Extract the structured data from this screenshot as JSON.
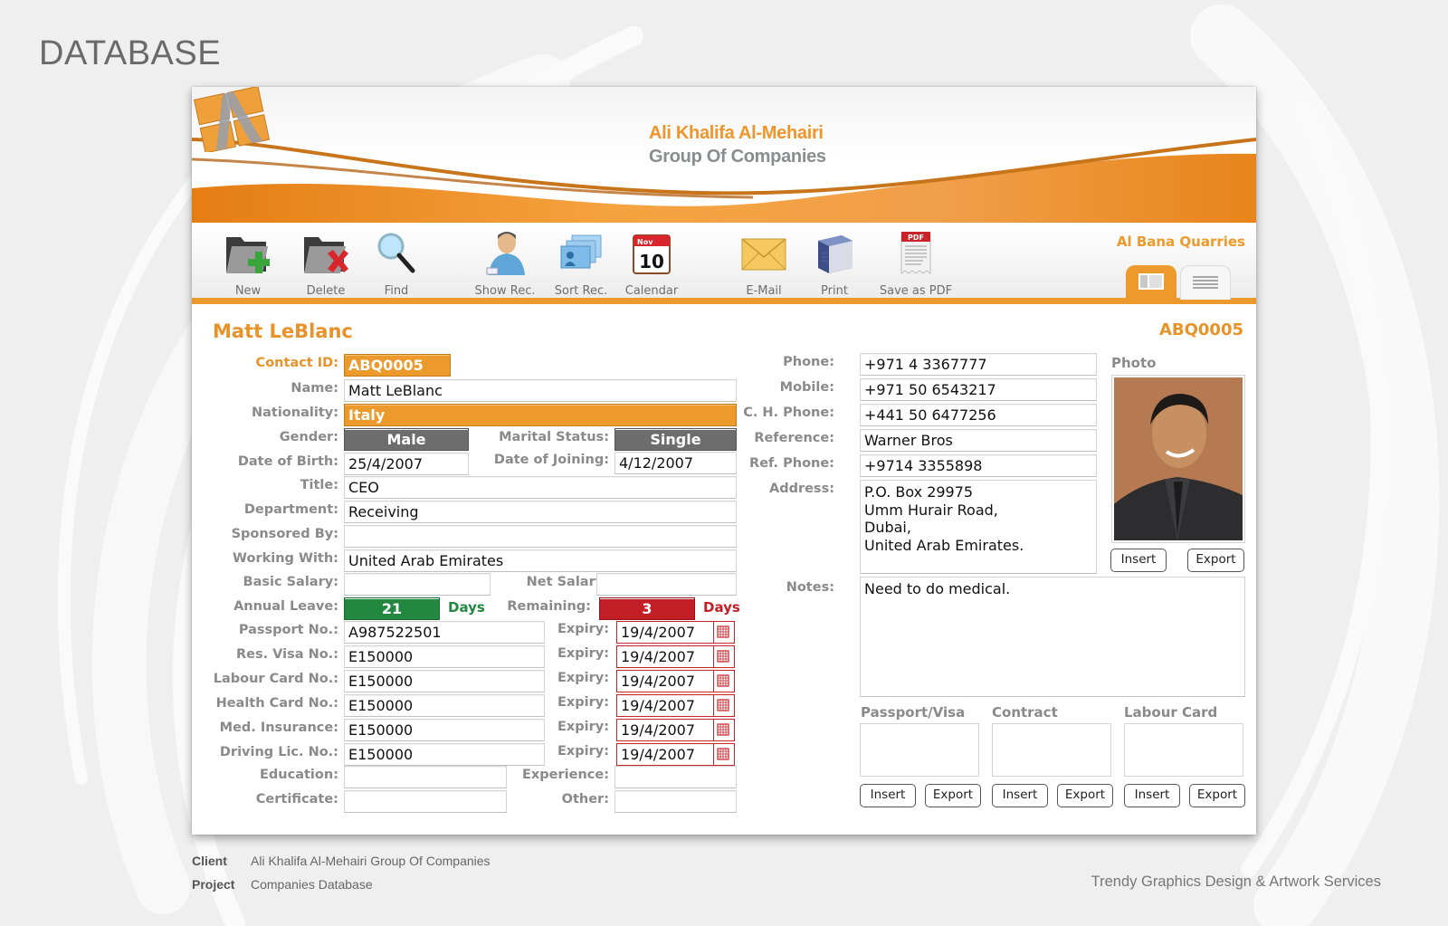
{
  "page": {
    "heading": "DATABASE",
    "footer": {
      "client_key": "Client",
      "client_value": "Ali Khalifa Al-Mehairi Group Of Companies",
      "project_key": "Project",
      "project_value": "Companies Database",
      "credit": "Trendy Graphics Design & Artwork Services"
    }
  },
  "banner": {
    "brand_line1": "Ali Khalifa Al-Mehairi",
    "brand_line2": "Group Of Companies",
    "calendar_month": "Nov",
    "calendar_day": "10",
    "pdf_badge": "PDF"
  },
  "toolbar": {
    "items": [
      {
        "label": "New",
        "icon": "folder-add-icon"
      },
      {
        "label": "Delete",
        "icon": "folder-delete-icon"
      },
      {
        "label": "Find",
        "icon": "magnifier-icon"
      },
      {
        "label": "Show Rec.",
        "icon": "user-icon"
      },
      {
        "label": "Sort Rec.",
        "icon": "cards-icon"
      },
      {
        "label": "Calendar",
        "icon": "calendar-icon"
      },
      {
        "label": "E-Mail",
        "icon": "envelope-icon"
      },
      {
        "label": "Print",
        "icon": "printer-icon"
      },
      {
        "label": "Save as PDF",
        "icon": "pdf-icon"
      }
    ],
    "company_name": "Al Bana Quarries",
    "view_tabs": [
      {
        "name": "form-view",
        "active": true
      },
      {
        "name": "list-view",
        "active": false
      }
    ]
  },
  "record": {
    "title_name": "Matt LeBlanc",
    "title_id": "ABQ0005",
    "left": {
      "contact_id": {
        "label": "Contact ID:",
        "value": "ABQ0005"
      },
      "name": {
        "label": "Name:",
        "value": "Matt LeBlanc"
      },
      "nationality": {
        "label": "Nationality:",
        "value": "Italy"
      },
      "gender": {
        "label": "Gender:",
        "value": "Male"
      },
      "marital_status": {
        "label": "Marital Status:",
        "value": "Single"
      },
      "dob": {
        "label": "Date of Birth:",
        "value": "25/4/2007"
      },
      "doj": {
        "label": "Date of Joining:",
        "value": "4/12/2007"
      },
      "title": {
        "label": "Title:",
        "value": "CEO"
      },
      "department": {
        "label": "Department:",
        "value": "Receiving"
      },
      "sponsored_by": {
        "label": "Sponsored By:",
        "value": ""
      },
      "working_with": {
        "label": "Working With:",
        "value": "United Arab Emirates"
      },
      "basic_salary": {
        "label": "Basic Salary:",
        "value": ""
      },
      "net_salary": {
        "label": "Net Salary:",
        "value": ""
      },
      "annual_leave": {
        "label": "Annual Leave:",
        "value": "21",
        "unit": "Days"
      },
      "remaining": {
        "label": "Remaining:",
        "value": "3",
        "unit": "Days"
      },
      "documents": [
        {
          "label": "Passport No.:",
          "value": "A987522501",
          "expiry_label": "Expiry:",
          "expiry": "19/4/2007"
        },
        {
          "label": "Res. Visa No.:",
          "value": "E150000",
          "expiry_label": "Expiry:",
          "expiry": "19/4/2007"
        },
        {
          "label": "Labour Card No.:",
          "value": "E150000",
          "expiry_label": "Expiry:",
          "expiry": "19/4/2007"
        },
        {
          "label": "Health Card No.:",
          "value": "E150000",
          "expiry_label": "Expiry:",
          "expiry": "19/4/2007"
        },
        {
          "label": "Med. Insurance:",
          "value": "E150000",
          "expiry_label": "Expiry:",
          "expiry": "19/4/2007"
        },
        {
          "label": "Driving Lic. No.:",
          "value": "E150000",
          "expiry_label": "Expiry:",
          "expiry": "19/4/2007"
        }
      ],
      "education": {
        "label": "Education:",
        "value": ""
      },
      "experience": {
        "label": "Experience:",
        "value": ""
      },
      "certificate": {
        "label": "Certificate:",
        "value": ""
      },
      "other": {
        "label": "Other:",
        "value": ""
      }
    },
    "right": {
      "phone": {
        "label": "Phone:",
        "value": "+971 4 3367777"
      },
      "mobile": {
        "label": "Mobile:",
        "value": "+971 50 6543217"
      },
      "ch_phone": {
        "label": "C. H. Phone:",
        "value": "+441 50 6477256"
      },
      "reference": {
        "label": "Reference:",
        "value": "Warner Bros"
      },
      "ref_phone": {
        "label": "Ref. Phone:",
        "value": "+9714 3355898"
      },
      "address": {
        "label": "Address:",
        "value": "P.O. Box 29975\nUmm Hurair Road,\nDubai,\nUnited Arab Emirates."
      },
      "notes": {
        "label": "Notes:",
        "value": "Need to do medical."
      },
      "photo": {
        "label": "Photo",
        "insert": "Insert",
        "export": "Export"
      },
      "attachments": [
        {
          "label": "Passport/Visa",
          "insert": "Insert",
          "export": "Export"
        },
        {
          "label": "Contract",
          "insert": "Insert",
          "export": "Export"
        },
        {
          "label": "Labour Card",
          "insert": "Insert",
          "export": "Export"
        }
      ]
    }
  },
  "colors": {
    "accent_orange": "#ec9a2b",
    "label_grey": "#8a8a8a",
    "status_green": "#23883f",
    "status_red": "#c21e25",
    "chip_grey": "#6d6d6d"
  }
}
